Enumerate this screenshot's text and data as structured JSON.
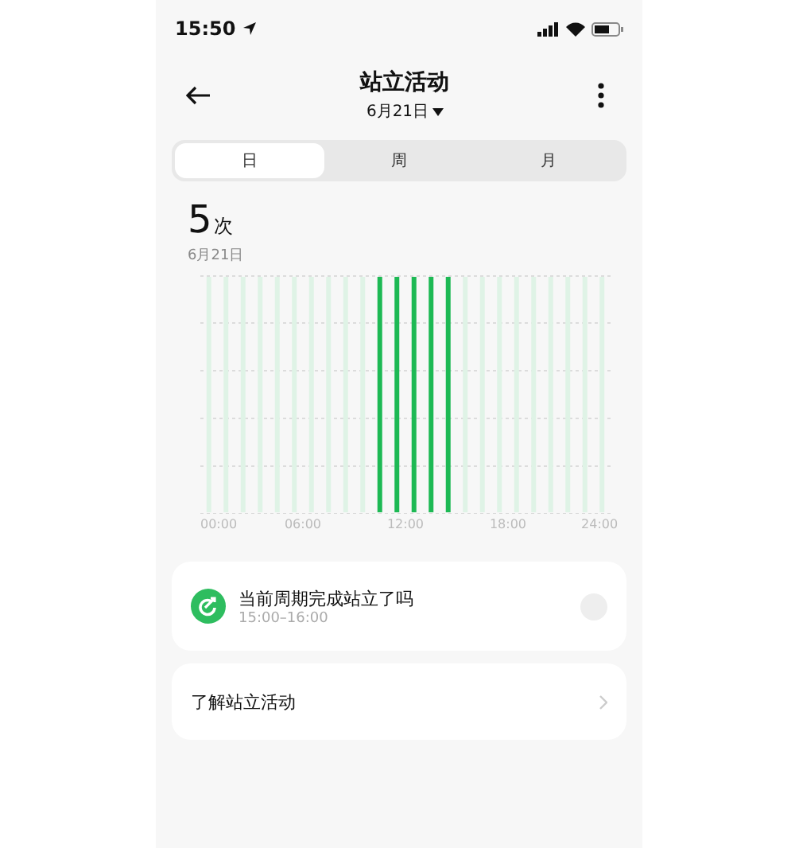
{
  "status_bar": {
    "time": "15:50"
  },
  "header": {
    "title": "站立活动",
    "date": "6月21日"
  },
  "tabs": [
    {
      "label": "日",
      "selected": true
    },
    {
      "label": "周",
      "selected": false
    },
    {
      "label": "月",
      "selected": false
    }
  ],
  "summary": {
    "count": "5",
    "unit": "次",
    "date": "6月21日"
  },
  "chart": {
    "axis_labels": [
      "00:00",
      "06:00",
      "12:00",
      "18:00",
      "24:00"
    ]
  },
  "reminder": {
    "title": "当前周期完成站立了吗",
    "time": "15:00–16:00",
    "checked": false
  },
  "link": {
    "label": "了解站立活动"
  }
}
